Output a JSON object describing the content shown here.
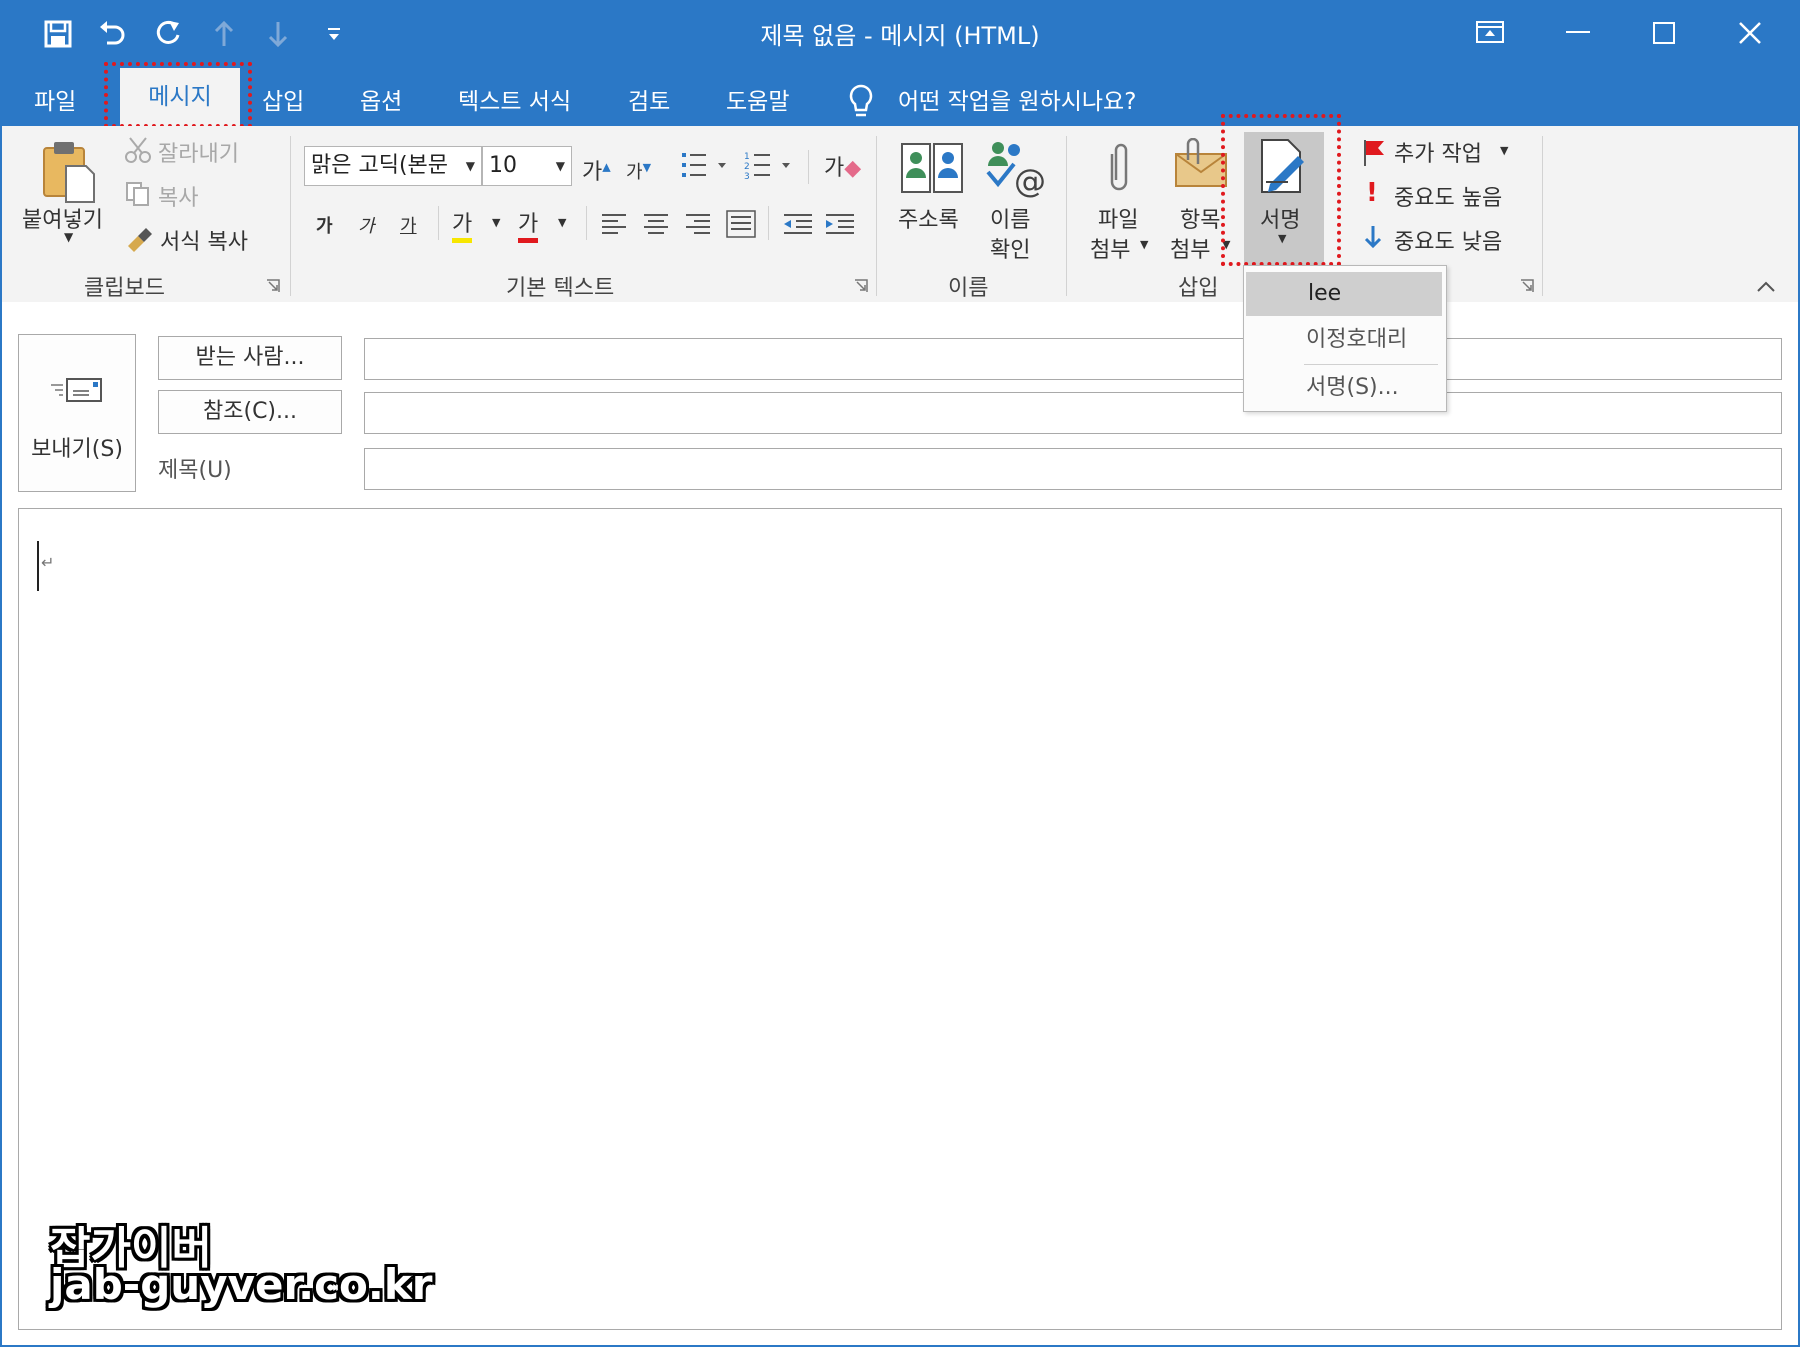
{
  "window": {
    "title": "제목 없음  -  메시지 (HTML)",
    "accent_color": "#2b78c6",
    "quick_access": [
      "save-icon",
      "undo-icon",
      "redo-icon",
      "up-arrow-icon",
      "down-arrow-icon",
      "customize-icon"
    ],
    "controls": [
      "ribbon-display-icon",
      "minimize-icon",
      "maximize-icon",
      "close-icon"
    ]
  },
  "tabs": [
    "파일",
    "메시지",
    "삽입",
    "옵션",
    "텍스트 서식",
    "검토",
    "도움말"
  ],
  "tell_me": "어떤 작업을 원하시나요?",
  "ribbon": {
    "clipboard": {
      "paste": "붙여넣기",
      "cut": "잘라내기",
      "copy": "복사",
      "format_painter": "서식 복사",
      "group": "클립보드"
    },
    "basic_text": {
      "font": "맑은 고딕(본문",
      "size": "10",
      "grow": "가",
      "shrink": "가",
      "bold": "가",
      "italic": "가",
      "underline": "가",
      "highlight": "가",
      "font_color": "가",
      "clear": "가",
      "group": "기본 텍스트"
    },
    "names": {
      "address_book": "주소록",
      "check_names_1": "이름",
      "check_names_2": "확인",
      "group": "이름"
    },
    "include": {
      "attach_file_1": "파일",
      "attach_file_2": "첨부",
      "attach_item_1": "항목",
      "attach_item_2": "첨부",
      "signature": "서명",
      "group": "삽입"
    },
    "tags": {
      "follow_up": "추가 작업",
      "high": "중요도 높음",
      "low": "중요도 낮음"
    }
  },
  "signature_menu": {
    "items": [
      "lee",
      "이정호대리"
    ],
    "more": "서명(S)..."
  },
  "compose": {
    "send": "보내기(S)",
    "to": "받는 사람...",
    "cc": "참조(C)...",
    "subject": "제목(U)",
    "body_mark": "↵"
  },
  "watermark": {
    "line1": "잡가이버",
    "line2": "jab-guyver.co.kr"
  }
}
